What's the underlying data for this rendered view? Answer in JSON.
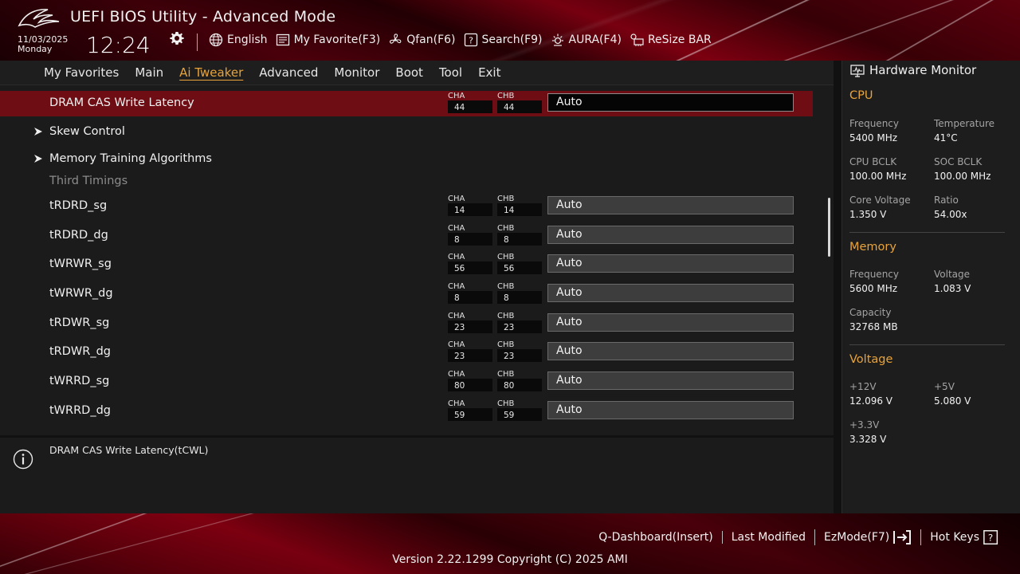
{
  "header": {
    "title": "UEFI BIOS Utility - Advanced Mode",
    "date": "11/03/2025",
    "day": "Monday",
    "time": "12:24",
    "toolbar": [
      {
        "label": "English",
        "icon": "globe-icon"
      },
      {
        "label": "My Favorite(F3)",
        "icon": "favorite-list-icon"
      },
      {
        "label": "Qfan(F6)",
        "icon": "fan-icon"
      },
      {
        "label": "Search(F9)",
        "icon": "search-icon"
      },
      {
        "label": "AURA(F4)",
        "icon": "aura-light-icon"
      },
      {
        "label": "ReSize BAR",
        "icon": "resize-bar-icon"
      }
    ]
  },
  "nav": {
    "tabs": [
      "My Favorites",
      "Main",
      "Ai Tweaker",
      "Advanced",
      "Monitor",
      "Boot",
      "Tool",
      "Exit"
    ],
    "active": "Ai Tweaker"
  },
  "main": {
    "selected_row": {
      "label": "DRAM CAS Write Latency",
      "cha_label": "CHA",
      "cha": "44",
      "chb_label": "CHB",
      "chb": "44",
      "value": "Auto"
    },
    "submenus": [
      "Skew Control",
      "Memory Training Algorithms"
    ],
    "section_header": "Third Timings",
    "timings": [
      {
        "label": "tRDRD_sg",
        "cha_label": "CHA",
        "cha": "14",
        "chb_label": "CHB",
        "chb": "14",
        "value": "Auto"
      },
      {
        "label": "tRDRD_dg",
        "cha_label": "CHA",
        "cha": "8",
        "chb_label": "CHB",
        "chb": "8",
        "value": "Auto"
      },
      {
        "label": "tWRWR_sg",
        "cha_label": "CHA",
        "cha": "56",
        "chb_label": "CHB",
        "chb": "56",
        "value": "Auto"
      },
      {
        "label": "tWRWR_dg",
        "cha_label": "CHA",
        "cha": "8",
        "chb_label": "CHB",
        "chb": "8",
        "value": "Auto"
      },
      {
        "label": "tRDWR_sg",
        "cha_label": "CHA",
        "cha": "23",
        "chb_label": "CHB",
        "chb": "23",
        "value": "Auto"
      },
      {
        "label": "tRDWR_dg",
        "cha_label": "CHA",
        "cha": "23",
        "chb_label": "CHB",
        "chb": "23",
        "value": "Auto"
      },
      {
        "label": "tWRRD_sg",
        "cha_label": "CHA",
        "cha": "80",
        "chb_label": "CHB",
        "chb": "80",
        "value": "Auto"
      },
      {
        "label": "tWRRD_dg",
        "cha_label": "CHA",
        "cha": "59",
        "chb_label": "CHB",
        "chb": "59",
        "value": "Auto"
      }
    ]
  },
  "help": {
    "text": "DRAM CAS Write Latency(tCWL)"
  },
  "hardware_monitor": {
    "title": "Hardware Monitor",
    "cpu": {
      "title": "CPU",
      "frequency_label": "Frequency",
      "frequency": "5400 MHz",
      "temperature_label": "Temperature",
      "temperature": "41°C",
      "cpu_bclk_label": "CPU BCLK",
      "cpu_bclk": "100.00 MHz",
      "soc_bclk_label": "SOC BCLK",
      "soc_bclk": "100.00 MHz",
      "core_voltage_label": "Core Voltage",
      "core_voltage": "1.350 V",
      "ratio_label": "Ratio",
      "ratio": "54.00x"
    },
    "memory": {
      "title": "Memory",
      "frequency_label": "Frequency",
      "frequency": "5600 MHz",
      "voltage_label": "Voltage",
      "voltage": "1.083 V",
      "capacity_label": "Capacity",
      "capacity": "32768 MB"
    },
    "voltage": {
      "title": "Voltage",
      "v12_label": "+12V",
      "v12": "12.096 V",
      "v5_label": "+5V",
      "v5": "5.080 V",
      "v33_label": "+3.3V",
      "v33": "3.328 V"
    }
  },
  "footer": {
    "keys": [
      "Q-Dashboard(Insert)",
      "Last Modified",
      "EzMode(F7)",
      "Hot Keys"
    ],
    "version": "Version 2.22.1299 Copyright (C) 2025 AMI"
  },
  "colors": {
    "accent": "#e8a33a",
    "selected_row": "#6e0e14",
    "brand_red": "#8a0012"
  }
}
